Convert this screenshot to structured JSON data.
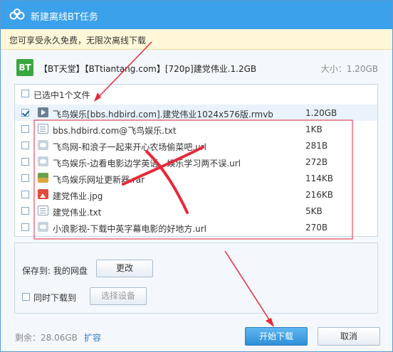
{
  "window": {
    "title": "新建离线BT任务"
  },
  "notice": {
    "text": "您可享受永久免费，无限次离线下载"
  },
  "torrent": {
    "badge": "BT",
    "name": "【BT天堂】【BTtiantang.com】[720p]建党伟业.1.2GB",
    "size_label": "大小：1.20GB"
  },
  "filelist": {
    "header": "已选中1个文件",
    "rows": [
      {
        "name": "飞鸟娱乐[bbs.hdbird.com].建党伟业1024x576版.rmvb",
        "size": "1.20GB",
        "checked": true,
        "icon": "video-icon"
      },
      {
        "name": "bbs.hdbird.com@飞鸟娱乐.txt",
        "size": "1KB",
        "checked": false,
        "icon": "text-file-icon"
      },
      {
        "name": "飞鸟网-和浪子一起来开心农场偷菜吧.url",
        "size": "281B",
        "checked": false,
        "icon": "url-icon"
      },
      {
        "name": "飞鸟娱乐-边看电影边学英语，娱乐学习两不误.url",
        "size": "272B",
        "checked": false,
        "icon": "url-icon"
      },
      {
        "name": "飞鸟娱乐网址更新器.rar",
        "size": "114KB",
        "checked": false,
        "icon": "archive-icon"
      },
      {
        "name": "建党伟业.jpg",
        "size": "216KB",
        "checked": false,
        "icon": "image-file-icon"
      },
      {
        "name": "建党伟业.txt",
        "size": "5KB",
        "checked": false,
        "icon": "text-file-icon"
      },
      {
        "name": "小浪影视-下载中英字幕电影的好地方.url",
        "size": "270B",
        "checked": false,
        "icon": "url-icon"
      }
    ]
  },
  "save": {
    "label": "保存到: 我的网盘",
    "change_button": "更改",
    "sync_label": "同时下载到",
    "device_button": "选择设备"
  },
  "footer": {
    "remaining": "剩余：28.06GB",
    "expand": "扩容",
    "start_button": "开始下载",
    "cancel_button": "取消"
  },
  "colors": {
    "titlebar": "#3ba1ea",
    "accent": "#2e8fd8",
    "annotation": "#e8283a",
    "bt_badge": "#3aa73e"
  }
}
